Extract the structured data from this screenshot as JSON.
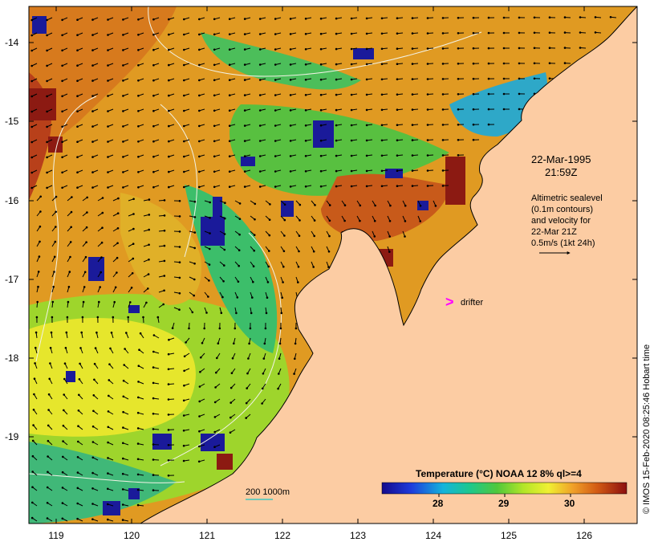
{
  "map": {
    "lat_labels": [
      "-14",
      "-15",
      "-16",
      "-17",
      "-18",
      "-19"
    ],
    "lon_labels": [
      "119",
      "120",
      "121",
      "122",
      "123",
      "124",
      "125",
      "126"
    ],
    "datetime_line1": "22-Mar-1995",
    "datetime_line2": "21:59Z",
    "info_lines": [
      "Altimetric sealevel",
      "(0.1m contours)",
      "and velocity for",
      "22-Mar 21Z",
      "0.5m/s (1kt 24h)"
    ],
    "drifter_label": "drifter",
    "drifter_symbol": ">",
    "depth_label": "200  1000m",
    "colorbar_title": "Temperature (°C) NOAA 12 8% ql>=4",
    "colorbar_ticks": [
      "28",
      "29",
      "30"
    ],
    "credit": "© IMOS 15-Feb-2020 08:25:46 Hobart time",
    "colors": {
      "land": "#fccca3",
      "drifter": "#ff00ff",
      "contour": "#f2f2e6",
      "depth_line": "#40c8c0"
    }
  }
}
